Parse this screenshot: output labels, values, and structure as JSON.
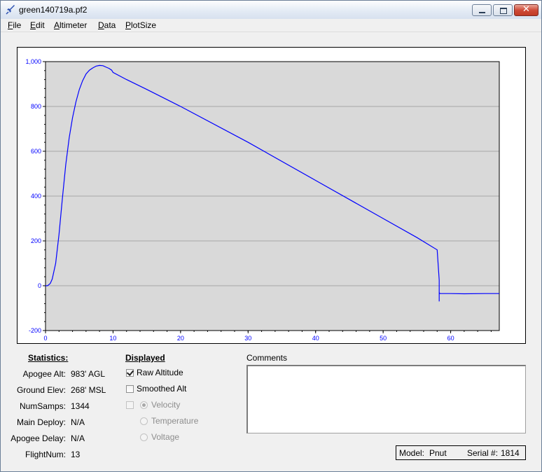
{
  "window": {
    "title": "green140719a.pf2"
  },
  "menu": [
    "File",
    "Edit",
    "Altimeter",
    "Data",
    "PlotSize"
  ],
  "chart_data": {
    "type": "line",
    "title": "",
    "xlabel": "",
    "ylabel": "",
    "xlim": [
      0,
      67.2
    ],
    "ylim": [
      -200,
      1000
    ],
    "x_ticks": [
      "0",
      "10",
      "20",
      "30",
      "40",
      "50",
      "60"
    ],
    "y_ticks": [
      "-200",
      "0",
      "200",
      "400",
      "600",
      "800",
      "1,000"
    ],
    "grid": "horizontal",
    "line_color": "#0000ff",
    "series": [
      {
        "x": [
          0,
          0.3,
          0.7,
          1.0,
          1.5,
          2.0,
          2.5,
          3.0,
          3.5,
          4.0,
          4.5,
          5.0,
          5.5,
          6.0,
          6.5,
          7.0,
          7.5,
          8.0,
          8.5,
          9.0,
          9.4,
          9.8,
          10.0,
          12.0,
          15.0,
          20.0,
          30.0,
          40.0,
          50.0,
          55.0,
          58.0,
          58.3,
          58.3,
          58.3,
          58.4,
          59.0,
          60.0,
          62.0,
          65.0,
          67.2
        ],
        "y": [
          0,
          0,
          10,
          30,
          100,
          230,
          390,
          540,
          660,
          750,
          820,
          875,
          915,
          945,
          962,
          972,
          980,
          983,
          982,
          975,
          970,
          962,
          952,
          920,
          876,
          800,
          640,
          470,
          300,
          215,
          160,
          25,
          -70,
          -30,
          -35,
          -35,
          -35,
          -36,
          -35,
          -35
        ]
      }
    ]
  },
  "statistics": {
    "heading": "Statistics:",
    "rows": [
      {
        "label": "Apogee Alt:",
        "value": "983' AGL"
      },
      {
        "label": "Ground Elev:",
        "value": "268' MSL"
      },
      {
        "label": "NumSamps:",
        "value": "1344"
      },
      {
        "label": "Main Deploy:",
        "value": "N/A"
      },
      {
        "label": "Apogee Delay:",
        "value": "N/A"
      },
      {
        "label": "FlightNum:",
        "value": "13"
      }
    ]
  },
  "displayed": {
    "heading": "Displayed",
    "raw_altitude": {
      "label": "Raw Altitude",
      "checked": true
    },
    "smoothed_alt": {
      "label": "Smoothed Alt",
      "checked": false
    },
    "extra": {
      "checked": false
    },
    "velocity": {
      "label": "Velocity",
      "selected": true
    },
    "temperature": {
      "label": "Temperature",
      "selected": false
    },
    "voltage": {
      "label": "Voltage",
      "selected": false
    }
  },
  "comments": {
    "label": "Comments",
    "value": ""
  },
  "device": {
    "model_label": "Model:",
    "model": "Pnut",
    "serial_label": "Serial #:",
    "serial": "1814"
  }
}
